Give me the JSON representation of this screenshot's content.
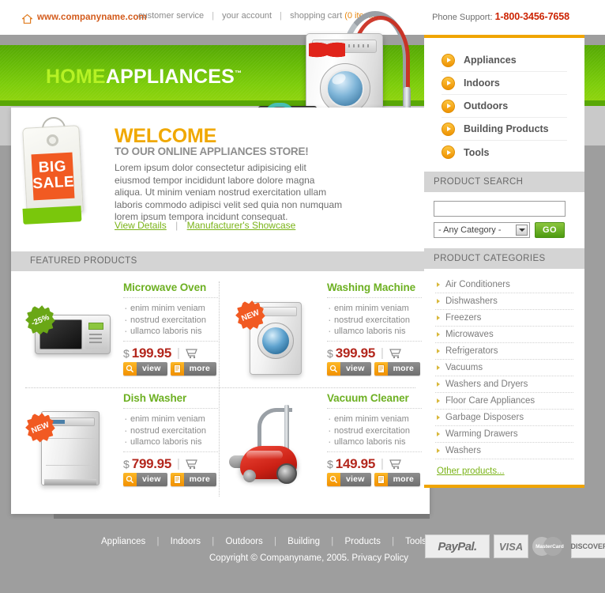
{
  "topbar": {
    "home_icon": "home-icon",
    "site_url": "www.companyname.com",
    "links": [
      {
        "label": "customer service"
      },
      {
        "label": "your account"
      },
      {
        "label": "shopping cart"
      }
    ],
    "cart_count": "(0 items)",
    "phone_label": "Phone Support:",
    "phone_number": "1-800-3456-7658",
    "separator": "|"
  },
  "header": {
    "logo_part1": "HOME",
    "logo_part2": "APPLIANCES",
    "trademark": "™"
  },
  "welcome": {
    "sale_tag_line1": "BIG",
    "sale_tag_line2": "SALE",
    "title": "WELCOME",
    "subtitle": "TO OUR ONLINE APPLIANCES STORE!",
    "body": "Lorem ipsum dolor consectetur adipisicing elit eiusmod tempor incididunt labore dolore magna aliqua. Ut minim veniam nostrud exercitation ullam laboris commodo adipisci velit sed quia non numquam lorem ipsum tempora incidunt consequat.",
    "link_details": "View Details",
    "link_showcase": "Manufacturer's Showcase",
    "link_separator": "|"
  },
  "featured": {
    "heading": "FEATURED PRODUCTS",
    "view_label": "view",
    "more_label": "more",
    "view_icon": "magnifier-icon",
    "more_icon": "document-icon",
    "cart_icon": "shopping-cart-icon",
    "currency": "$",
    "products": [
      {
        "name": "Microwave Oven",
        "features": [
          "enim minim veniam",
          "nostrud exercitation",
          "ullamco laboris nis"
        ],
        "price": "199.95",
        "badge": "-25%",
        "badge_type": "green",
        "image": "microwave-oven-image"
      },
      {
        "name": "Washing Machine",
        "features": [
          "enim minim veniam",
          "nostrud exercitation",
          "ullamco laboris nis"
        ],
        "price": "399.95",
        "badge": "NEW",
        "badge_type": "orange",
        "image": "washing-machine-image"
      },
      {
        "name": "Dish Washer",
        "features": [
          "enim minim veniam",
          "nostrud exercitation",
          "ullamco laboris nis"
        ],
        "price": "799.95",
        "badge": "NEW",
        "badge_type": "orange",
        "image": "dish-washer-image"
      },
      {
        "name": "Vacuum Cleaner",
        "features": [
          "enim minim veniam",
          "nostrud exercitation",
          "ullamco laboris nis"
        ],
        "price": "149.95",
        "badge": "",
        "badge_type": "none",
        "image": "vacuum-cleaner-image"
      }
    ]
  },
  "sidebar": {
    "nav_items": [
      {
        "label": "Appliances"
      },
      {
        "label": "Indoors"
      },
      {
        "label": "Outdoors"
      },
      {
        "label": "Building Products"
      },
      {
        "label": "Tools"
      }
    ],
    "search": {
      "heading": "PRODUCT SEARCH",
      "input_value": "",
      "input_placeholder": "",
      "category_selected": "- Any Category -",
      "go_label": "GO"
    },
    "categories": {
      "heading": "PRODUCT CATEGORIES",
      "items": [
        {
          "label": "Air Conditioners"
        },
        {
          "label": "Dishwashers"
        },
        {
          "label": "Freezers"
        },
        {
          "label": "Microwaves"
        },
        {
          "label": "Refrigerators"
        },
        {
          "label": "Vacuums"
        },
        {
          "label": "Washers and Dryers"
        },
        {
          "label": "Floor Care Appliances"
        },
        {
          "label": "Garbage Disposers"
        },
        {
          "label": "Warming Drawers"
        },
        {
          "label": "Washers"
        }
      ],
      "other_link": "Other products..."
    }
  },
  "footer": {
    "links": [
      {
        "label": "Appliances"
      },
      {
        "label": "Indoors"
      },
      {
        "label": "Outdoors"
      },
      {
        "label": "Building"
      },
      {
        "label": "Products"
      },
      {
        "label": "Tools"
      }
    ],
    "separator": "|",
    "copyright": "Copyright © Companyname, 2005. Privacy Policy",
    "payments": [
      {
        "label": "PayPal."
      },
      {
        "label": "VISA"
      },
      {
        "label": "MasterCard"
      },
      {
        "label": "DISCOVER"
      }
    ]
  },
  "colors": {
    "brand_green": "#7dcd0a",
    "accent_orange": "#f0a500",
    "price_red": "#b3271d",
    "title_green": "#6db022",
    "phone_red": "#cc2200",
    "page_gray": "#9e9e9e"
  }
}
